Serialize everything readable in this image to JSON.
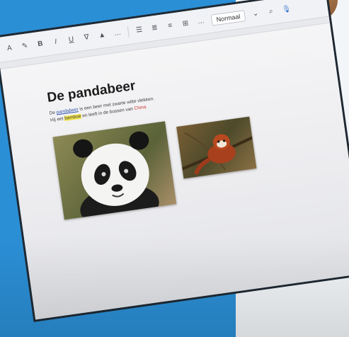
{
  "toolbar": {
    "style_value": "Normaal"
  },
  "document": {
    "title": "De pandabeer",
    "line1_a": "De ",
    "line1_link": "pandabeer",
    "line1_b": " is een beer met zwarte witte vlekken.",
    "line2_a": "Hij eet ",
    "line2_hl": "bamboe",
    "line2_b": " en leeft in de bossen van ",
    "line2_red": "China"
  },
  "images": {
    "panda": "giant-panda-photo",
    "redpanda": "red-panda-photo"
  }
}
